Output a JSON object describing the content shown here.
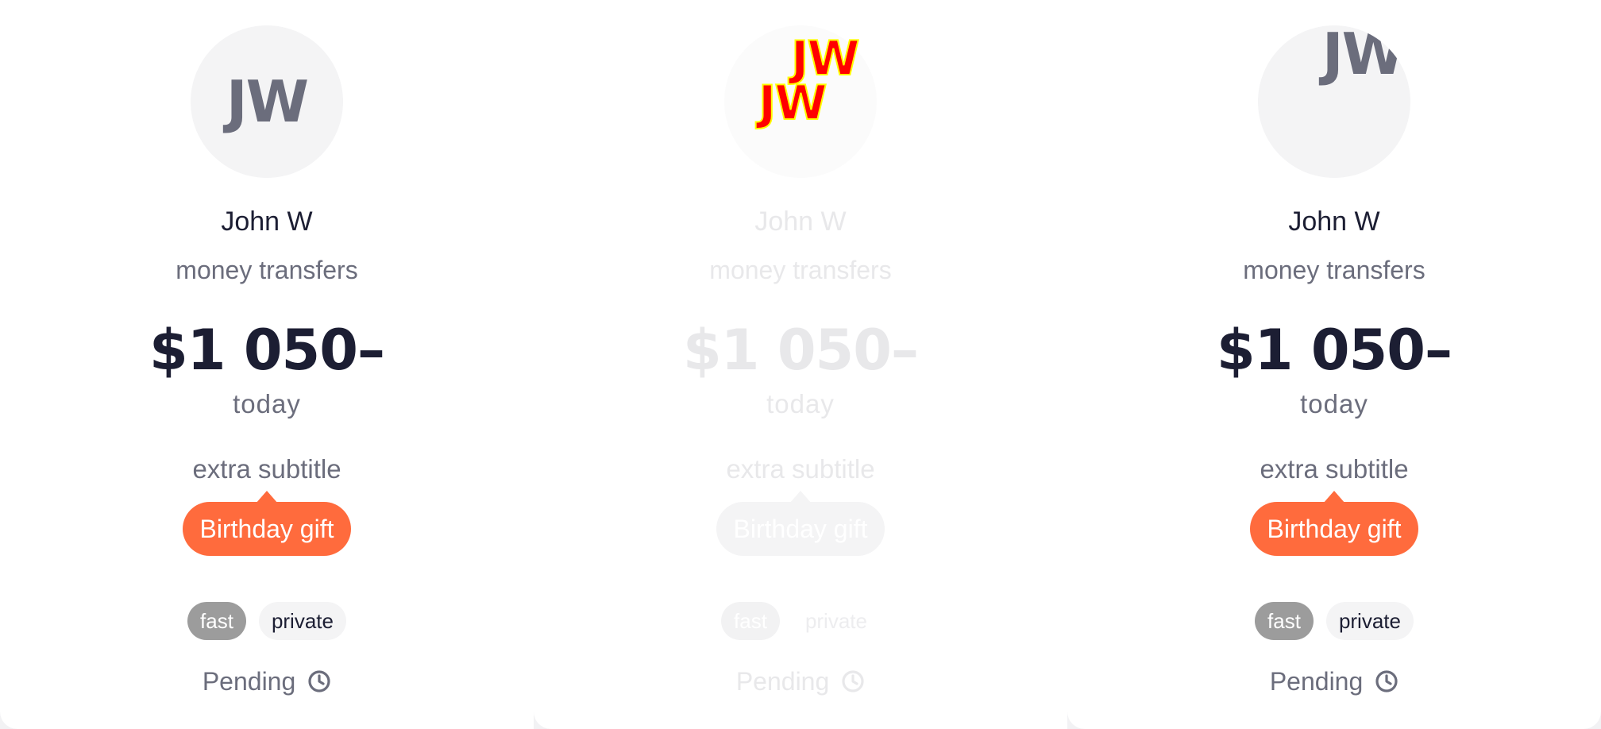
{
  "cards": [
    {
      "avatar_initials": "JW",
      "name": "John W",
      "category": "money transfers",
      "amount": "$1 050–",
      "date": "today",
      "extra": "extra subtitle",
      "gift": "Birthday gift",
      "tags": [
        "fast",
        "private"
      ],
      "status": "Pending",
      "status_icon": "clock-icon"
    },
    {
      "avatar_initials": "JW",
      "avatar_initials_secondary": "JW",
      "name": "John W",
      "category": "money transfers",
      "amount": "$1 050–",
      "date": "today",
      "extra": "extra subtitle",
      "gift": "Birthday gift",
      "tags": [
        "fast",
        "private"
      ],
      "status": "Pending",
      "status_icon": "clock-icon"
    },
    {
      "avatar_initials": "JW",
      "name": "John W",
      "category": "money transfers",
      "amount": "$1 050–",
      "date": "today",
      "extra": "extra subtitle",
      "gift": "Birthday gift",
      "tags": [
        "fast",
        "private"
      ],
      "status": "Pending",
      "status_icon": "clock-icon"
    }
  ],
  "colors": {
    "accent": "#ff6b3d",
    "text_primary": "#1c1e33",
    "text_secondary": "#6b6d7c",
    "tag_fast": "#9c9c9c",
    "avatar_bg": "#f4f4f5"
  }
}
